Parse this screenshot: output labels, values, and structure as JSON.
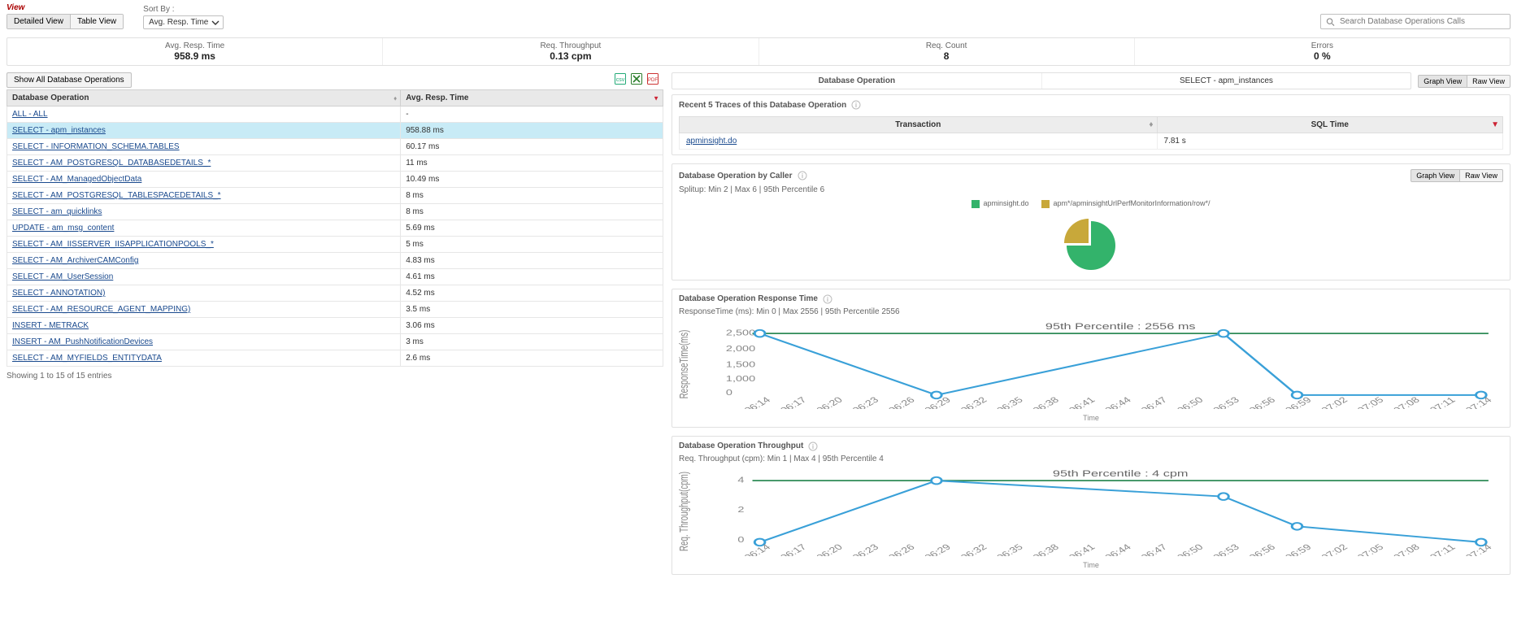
{
  "topbar": {
    "view_label": "View",
    "sort_label": "Sort By :",
    "detailed_view": "Detailed View",
    "table_view": "Table View",
    "sort_value": "Avg. Resp. Time",
    "search_placeholder": "Search Database Operations Calls"
  },
  "kpis": {
    "avg_resp": {
      "label": "Avg. Resp. Time",
      "value": "958.9 ms"
    },
    "thr": {
      "label": "Req. Throughput",
      "value": "0.13 cpm"
    },
    "count": {
      "label": "Req. Count",
      "value": "8"
    },
    "errors": {
      "label": "Errors",
      "value": "0 %"
    }
  },
  "left": {
    "show_all": "Show All Database Operations",
    "col1": "Database Operation",
    "col2": "Avg. Resp. Time",
    "rows": [
      {
        "op": "ALL - ALL",
        "rt": "-"
      },
      {
        "op": "SELECT - apm_instances",
        "rt": "958.88 ms",
        "sel": true
      },
      {
        "op": "SELECT - INFORMATION_SCHEMA.TABLES",
        "rt": "60.17 ms"
      },
      {
        "op": "SELECT - AM_POSTGRESQL_DATABASEDETAILS_*",
        "rt": "11 ms"
      },
      {
        "op": "SELECT - AM_ManagedObjectData",
        "rt": "10.49 ms"
      },
      {
        "op": "SELECT - AM_POSTGRESQL_TABLESPACEDETAILS_*",
        "rt": "8 ms"
      },
      {
        "op": "SELECT - am_quicklinks",
        "rt": "8 ms"
      },
      {
        "op": "UPDATE - am_msg_content",
        "rt": "5.69 ms"
      },
      {
        "op": "SELECT - AM_IISSERVER_IISAPPLICATIONPOOLS_*",
        "rt": "5 ms"
      },
      {
        "op": "SELECT - AM_ArchiverCAMConfig",
        "rt": "4.83 ms"
      },
      {
        "op": "SELECT - AM_UserSession",
        "rt": "4.61 ms"
      },
      {
        "op": "SELECT - ANNOTATION)",
        "rt": "4.52 ms"
      },
      {
        "op": "SELECT - AM_RESOURCE_AGENT_MAPPING)",
        "rt": "3.5 ms"
      },
      {
        "op": "INSERT - METRACK",
        "rt": "3.06 ms"
      },
      {
        "op": "INSERT - AM_PushNotificationDevices",
        "rt": "3 ms"
      },
      {
        "op": "SELECT - AM_MYFIELDS_ENTITYDATA",
        "rt": "2.6 ms"
      }
    ],
    "showing": "Showing 1 to 15 of 15 entries"
  },
  "right": {
    "db_op_label": "Database Operation",
    "db_op_value": "SELECT - apm_instances",
    "graph_view": "Graph View",
    "raw_view": "Raw View",
    "traces": {
      "title": "Recent 5 Traces of this Database Operation",
      "col_tx": "Transaction",
      "col_sql": "SQL Time",
      "row_tx": "apminsight.do",
      "row_sql": "7.81 s"
    },
    "caller": {
      "title": "Database Operation by Caller",
      "stats": "Splitup: Min 2  |  Max 6  |  95th Percentile 6",
      "legend1": "apminsight.do",
      "legend2": "apm*/apminsightUrlPerfMonitorInformation/row*/"
    },
    "resp": {
      "title": "Database Operation Response Time",
      "stats": "ResponseTime (ms): Min 0  |  Max 2556  |  95th Percentile 2556",
      "annot": "95th Percentile : 2556 ms",
      "ylabel": "ResponseTime(ms)",
      "xlabel": "Time"
    },
    "thr": {
      "title": "Database Operation Throughput",
      "stats": "Req. Throughput (cpm): Min 1  |  Max 4  |  95th Percentile 4",
      "annot": "95th Percentile : 4 cpm",
      "ylabel": "Req. Throughput(cpm)",
      "xlabel": "Time"
    }
  },
  "chart_data": [
    {
      "type": "pie",
      "title": "Database Operation by Caller",
      "series": [
        {
          "name": "apminsight.do",
          "value": 75,
          "color": "#33b36b"
        },
        {
          "name": "apm*/apminsightUrlPerfMonitorInformation/row*/",
          "value": 25,
          "color": "#c8a83a"
        }
      ]
    },
    {
      "type": "line",
      "title": "Database Operation Response Time",
      "xlabel": "Time",
      "ylabel": "ResponseTime(ms)",
      "ylim": [
        0,
        2556
      ],
      "annotation": "95th Percentile : 2556 ms",
      "x": [
        "06:14",
        "06:17",
        "06:20",
        "06:23",
        "06:26",
        "06:29",
        "06:32",
        "06:35",
        "06:38",
        "06:41",
        "06:44",
        "06:47",
        "06:50",
        "06:53",
        "06:56",
        "06:59",
        "07:02",
        "07:05",
        "07:08",
        "07:11",
        "07:14"
      ],
      "values": [
        2556,
        null,
        null,
        null,
        null,
        0,
        null,
        null,
        null,
        null,
        null,
        null,
        null,
        2556,
        null,
        0,
        null,
        null,
        null,
        null,
        0
      ]
    },
    {
      "type": "line",
      "title": "Database Operation Throughput",
      "xlabel": "Time",
      "ylabel": "Req. Throughput(cpm)",
      "ylim": [
        0,
        4
      ],
      "annotation": "95th Percentile : 4 cpm",
      "x": [
        "06:14",
        "06:17",
        "06:20",
        "06:23",
        "06:26",
        "06:29",
        "06:32",
        "06:35",
        "06:38",
        "06:41",
        "06:44",
        "06:47",
        "06:50",
        "06:53",
        "06:56",
        "06:59",
        "07:02",
        "07:05",
        "07:08",
        "07:11",
        "07:14"
      ],
      "values": [
        0,
        null,
        null,
        null,
        null,
        4,
        null,
        null,
        null,
        null,
        null,
        null,
        null,
        3,
        null,
        1,
        null,
        null,
        null,
        null,
        0
      ]
    }
  ]
}
